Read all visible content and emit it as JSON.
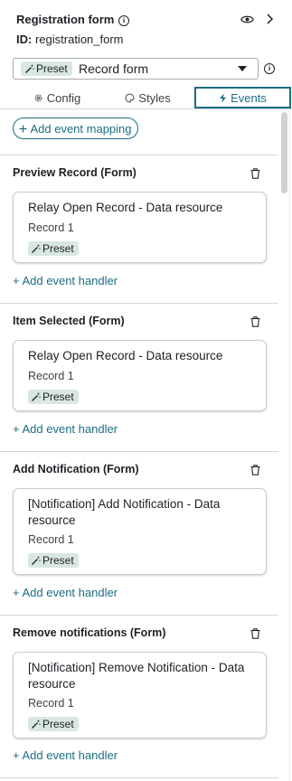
{
  "header": {
    "title": "Registration form",
    "id_label": "ID:",
    "id_value": "registration_form"
  },
  "select": {
    "preset_label": "Preset",
    "value": "Record form"
  },
  "tabs": [
    {
      "label": "Config"
    },
    {
      "label": "Styles"
    },
    {
      "label": "Events",
      "active": true
    }
  ],
  "events": {
    "add_mapping_label": "Add event mapping",
    "add_handler_label": "Add event handler",
    "mappings": [
      {
        "event": "Preview Record (Form)",
        "handler_title": "Relay Open Record - Data resource",
        "handler_sub": "Record 1",
        "chip": "Preset"
      },
      {
        "event": "Item Selected (Form)",
        "handler_title": "Relay Open Record - Data resource",
        "handler_sub": "Record 1",
        "chip": "Preset"
      },
      {
        "event": "Add Notification (Form)",
        "handler_title": "[Notification] Add Notification - Data resource",
        "handler_sub": "Record 1",
        "chip": "Preset"
      },
      {
        "event": "Remove notifications (Form)",
        "handler_title": "[Notification] Remove Notification - Data resource",
        "handler_sub": "Record 1",
        "chip": "Preset"
      }
    ]
  },
  "colors": {
    "accent": "#1b6d83",
    "chip_bg": "#d9e7e3",
    "text": "#1d2125",
    "divider": "#d4d6d8"
  },
  "icons": [
    "info-icon",
    "eye-icon",
    "chevron-right-icon",
    "wand-icon",
    "caret-down-icon",
    "gear-icon",
    "palette-icon",
    "lightning-icon",
    "plus-icon",
    "trash-icon"
  ]
}
